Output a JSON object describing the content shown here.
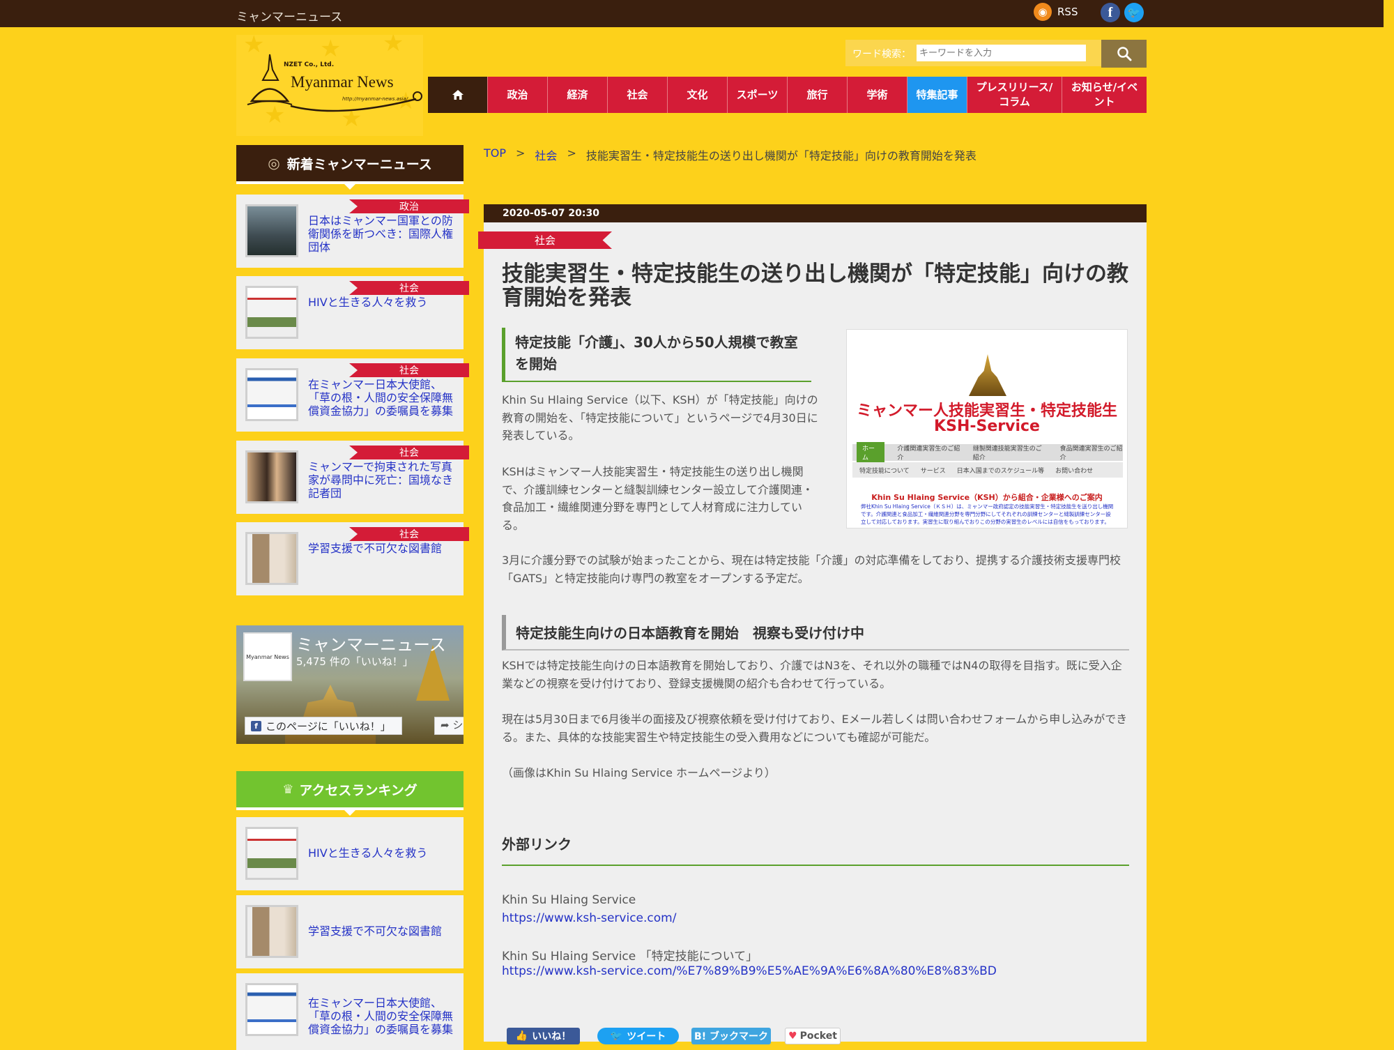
{
  "topbar": {
    "site_title": "ミャンマーニュース",
    "rss_label": "RSS",
    "facebook_glyph": "f",
    "twitter_glyph": "🐦"
  },
  "logo": {
    "company": "NZET Co., Ltd.",
    "name": "Myanmar News",
    "url": "http://myanmar-news.asia/"
  },
  "search": {
    "label": "ワード検索：",
    "placeholder": "キーワードを入力"
  },
  "nav": {
    "items": [
      {
        "label": "政治"
      },
      {
        "label": "経済"
      },
      {
        "label": "社会"
      },
      {
        "label": "文化"
      },
      {
        "label": "スポーツ"
      },
      {
        "label": "旅行"
      },
      {
        "label": "学術"
      },
      {
        "label": "特集記事"
      },
      {
        "label": "プレスリリース/\nコラム"
      },
      {
        "label": "お知らせ/イベ\nント"
      }
    ],
    "feature_color": "#1e96f0",
    "accent_color": "#d41c37"
  },
  "sidebar": {
    "latest_heading": "新着ミャンマーニュース",
    "latest": [
      {
        "category": "政治",
        "title": "日本はミャンマー国軍との防衛関係を断つべき：国際人権団体"
      },
      {
        "category": "社会",
        "title": "HIVと生きる人々を救う"
      },
      {
        "category": "社会",
        "title": "在ミャンマー日本大使館、「草の根・人間の安全保障無償資金協力」の委嘱員を募集"
      },
      {
        "category": "社会",
        "title": "ミャンマーで拘束された写真家が尋問中に死亡：国境なき記者団"
      },
      {
        "category": "社会",
        "title": "学習支援で不可欠な図書館"
      }
    ],
    "facebook": {
      "page_name": "ミャンマーニュース",
      "likes": "5,475 件の「いいね！」",
      "like_button": "このページに「いいね！」",
      "share_button": "シ",
      "logo_text": "Myanmar News"
    },
    "ranking_heading": "アクセスランキング",
    "ranking": [
      {
        "title": "HIVと生きる人々を救う"
      },
      {
        "title": "学習支援で不可欠な図書館"
      },
      {
        "title": "在ミャンマー日本大使館、「草の根・人間の安全保障無償資金協力」の委嘱員を募集"
      }
    ]
  },
  "breadcrumb": {
    "top": "TOP",
    "sep": ">",
    "category": "社会",
    "current": "技能実習生・特定技能生の送り出し機関が「特定技能」向けの教育開始を発表"
  },
  "article": {
    "date": "2020-05-07 20:30",
    "category": "社会",
    "headline": "技能実習生・特定技能生の送り出し機関が「特定技能」向けの教育開始を発表",
    "subhead1": "特定技能「介護」、30人から50人規模で教室を開始",
    "para1": "Khin Su Hlaing Service（以下、KSH）が「特定技能」向けの教育の開始を、「特定技能について」というページで4月30日に発表している。",
    "para2": "KSHはミャンマー人技能実習生・特定技能生の送り出し機関で、介護訓練センターと縫製訓練センター設立して介護関連・食品加工・繊維関連分野を専門として人材育成に注力している。",
    "para3": "3月に介護分野での試験が始まったことから、現在は特定技能「介護」の対応準備をしており、提携する介護技術支援専門校「GATS」と特定技能向け専門の教室をオープンする予定だ。",
    "subhead2": "特定技能生向けの日本語教育を開始　視察も受け付け中",
    "para4": "KSHでは特定技能生向けの日本語教育を開始しており、介護ではN3を、それ以外の職種ではN4の取得を目指す。既に受入企業などの視察を受け付けており、登録支援機関の紹介も合わせて行っている。",
    "para5": "現在は5月30日まで6月後半の面接及び視察依頼を受け付けており、Eメール若しくは問い合わせフォームから申し込みができる。また、具体的な技能実習生や特定技能生の受入費用などについても確認が可能だ。",
    "caption": "（画像はKhin Su Hlaing Service ホームページより）",
    "external_heading": "外部リンク",
    "links": [
      {
        "label": "Khin Su Hlaing Service",
        "url": "https://www.ksh-service.com/"
      },
      {
        "label": "Khin Su Hlaing Service 「特定技能について」",
        "url": "https://www.ksh-service.com/%E7%89%B9%E5%AE%9A%E6%8A%80%E8%83%BD"
      }
    ],
    "image": {
      "title1": "ミャンマー人技能実習生・特定技能生",
      "title2": "KSH-Service",
      "menu1": [
        "ホーム",
        "介護関連実習生のご紹介",
        "縫製関連技能実習生のご紹介",
        "食品関連実習生のご紹介"
      ],
      "menu2": [
        "特定技能について",
        "サービス",
        "日本入国までのスケジュール等",
        "お問い合わせ"
      ],
      "notice": "Khin Su Hlaing Service（KSH）から組合・企業様へのご案内",
      "body": "弊社Khin Su Hlaing Service（ＫＳＨ）は、ミャンマー政府認定の技能実習生・特定技能生を送り出し機関です。介護関連と食品加工・繊維関連分野を専門分野にしてそれぞれの訓練センターと縫製訓練センター設立して対応しております。実習生に取り組んでおりこの分野の実習生のレベルには自信をもっております。"
    },
    "share": {
      "like": "いいね！",
      "tweet": "ツイート",
      "bookmark": "B! ブックマーク",
      "pocket": "Pocket"
    }
  }
}
